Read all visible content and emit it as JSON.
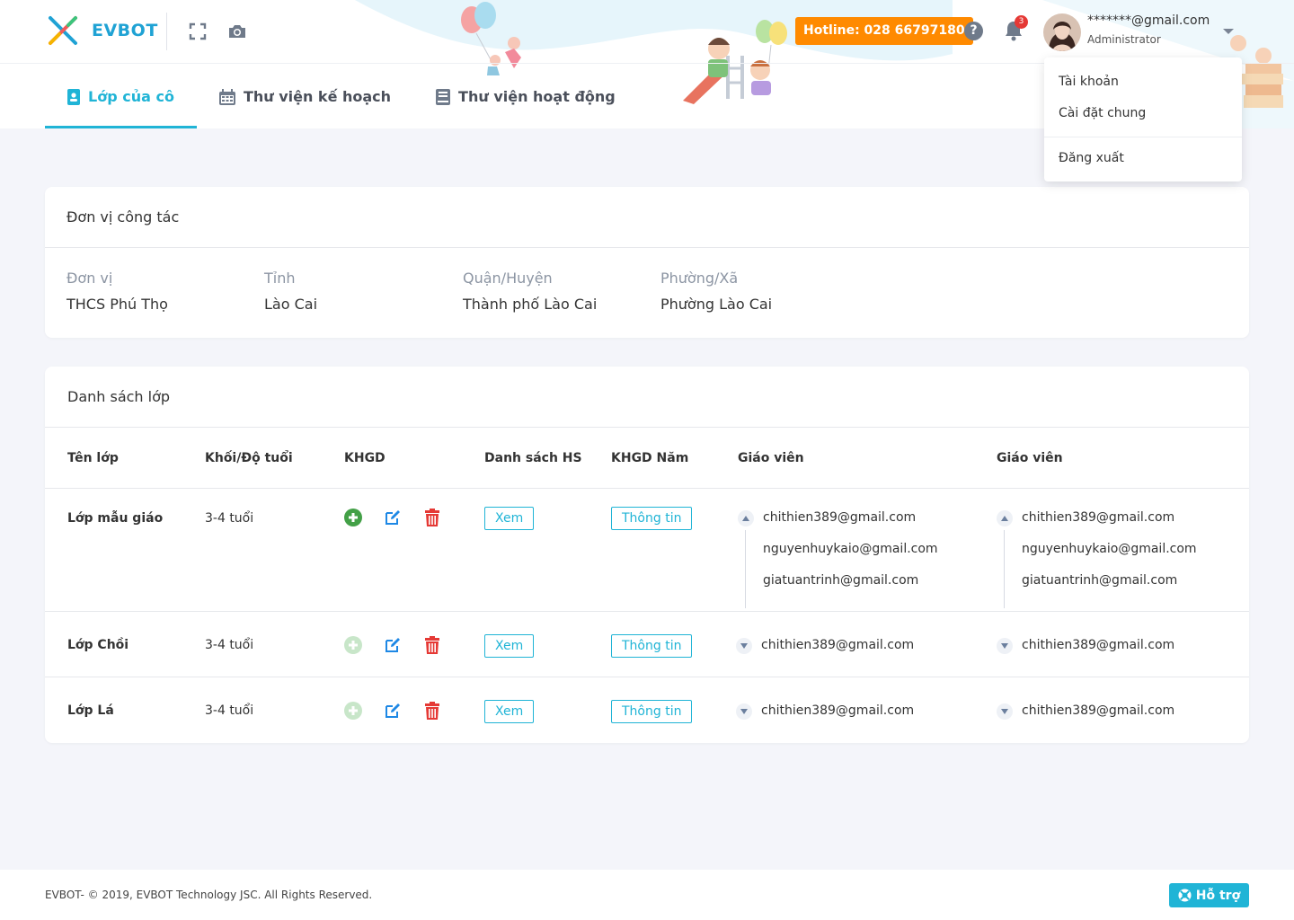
{
  "app": {
    "logo_text": "EVBOT",
    "hotline": "Hotline: 028 66797180",
    "notification_count": "3"
  },
  "user": {
    "email": "*******@gmail.com",
    "role": "Administrator"
  },
  "user_menu": {
    "account": "Tài khoản",
    "settings": "Cài đặt chung",
    "logout": "Đăng xuất"
  },
  "tabs": [
    {
      "label": "Lớp của cô",
      "icon": "id-badge-icon",
      "active": true
    },
    {
      "label": "Thư viện kế hoạch",
      "icon": "calendar-icon",
      "active": false
    },
    {
      "label": "Thư viện hoạt động",
      "icon": "book-icon",
      "active": false
    }
  ],
  "unit": {
    "title": "Đơn vị công tác",
    "fields": [
      {
        "label": "Đơn vị",
        "value": "THCS Phú Thọ"
      },
      {
        "label": "Tỉnh",
        "value": "Lào Cai"
      },
      {
        "label": "Quận/Huyện",
        "value": "Thành phố Lào Cai"
      },
      {
        "label": "Phường/Xã",
        "value": "Phường Lào Cai"
      }
    ]
  },
  "classes": {
    "title": "Danh sách lớp",
    "headers": [
      "Tên lớp",
      "Khối/Độ tuổi",
      "KHGD",
      "Danh sách HS",
      "KHGD Năm",
      "Giáo viên",
      "Giáo viên"
    ],
    "view_label": "Xem",
    "info_label": "Thông tin",
    "rows": [
      {
        "name": "Lớp mẫu giáo",
        "age": "3-4 tuổi",
        "add_enabled": true,
        "expanded": true,
        "teachers_a": [
          "chithien389@gmail.com",
          "nguyenhuykaio@gmail.com",
          "giatuantrinh@gmail.com"
        ],
        "teachers_b": [
          "chithien389@gmail.com",
          "nguyenhuykaio@gmail.com",
          "giatuantrinh@gmail.com"
        ]
      },
      {
        "name": "Lớp Chồi",
        "age": "3-4 tuổi",
        "add_enabled": false,
        "expanded": false,
        "teachers_a": [
          "chithien389@gmail.com"
        ],
        "teachers_b": [
          "chithien389@gmail.com"
        ]
      },
      {
        "name": "Lớp Lá",
        "age": "3-4 tuổi",
        "add_enabled": false,
        "expanded": false,
        "teachers_a": [
          "chithien389@gmail.com"
        ],
        "teachers_b": [
          "chithien389@gmail.com"
        ]
      }
    ]
  },
  "footer": {
    "copyright": "EVBOT- © 2019, EVBOT Technology JSC. All Rights Reserved.",
    "support_label": "Hỗ trợ"
  },
  "colors": {
    "accent": "#20b4d6",
    "hotline": "#ff8a00",
    "add": "#43a047",
    "edit": "#1e88e5",
    "delete": "#e53935"
  }
}
